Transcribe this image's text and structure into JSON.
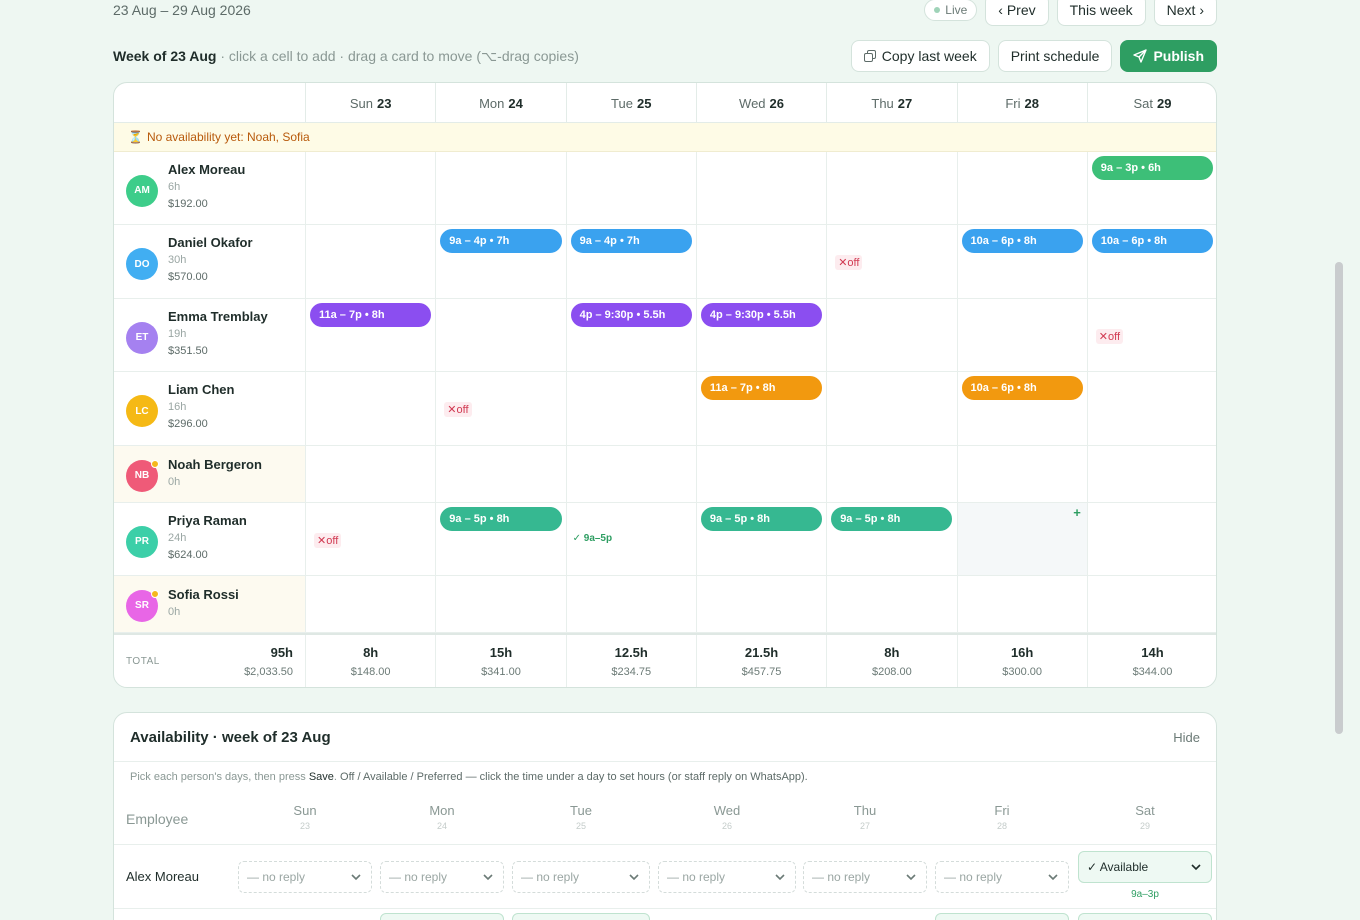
{
  "header": {
    "date_range": "23 Aug – 29 Aug 2026",
    "live_label": "Live",
    "prev_label": "‹ Prev",
    "this_week_label": "This week",
    "next_label": "Next ›"
  },
  "week": {
    "title": "Week of 23 Aug",
    "hint": " · click a cell to add · drag a card to move (⌥-drag copies)",
    "copy_label": "Copy last week",
    "print_label": "Print schedule",
    "publish_label": "Publish"
  },
  "days": [
    {
      "dow": "Sun",
      "num": "23"
    },
    {
      "dow": "Mon",
      "num": "24"
    },
    {
      "dow": "Tue",
      "num": "25"
    },
    {
      "dow": "Wed",
      "num": "26"
    },
    {
      "dow": "Thu",
      "num": "27"
    },
    {
      "dow": "Fri",
      "num": "28"
    },
    {
      "dow": "Sat",
      "num": "29"
    }
  ],
  "notice": {
    "icon": "hourglass-icon",
    "text": "No availability yet: Noah, Sofia"
  },
  "employees": [
    {
      "initials": "AM",
      "name": "Alex Moreau",
      "hours": "6h",
      "cost": "$192.00",
      "color": "#3dcd8a",
      "pending": false,
      "cells": [
        null,
        null,
        null,
        null,
        null,
        null,
        {
          "type": "shift",
          "label": "9a – 3p • 6h"
        }
      ]
    },
    {
      "initials": "DO",
      "name": "Daniel Okafor",
      "hours": "30h",
      "cost": "$570.00",
      "color": "#41aef2",
      "pending": false,
      "cells": [
        null,
        {
          "type": "shift",
          "label": "9a – 4p • 7h"
        },
        {
          "type": "shift",
          "label": "9a – 4p • 7h"
        },
        null,
        {
          "type": "off",
          "label": "✕off"
        },
        {
          "type": "shift",
          "label": "10a – 6p • 8h"
        },
        {
          "type": "shift",
          "label": "10a – 6p • 8h"
        }
      ]
    },
    {
      "initials": "ET",
      "name": "Emma Tremblay",
      "hours": "19h",
      "cost": "$351.50",
      "color": "#a581f0",
      "pending": false,
      "cells": [
        {
          "type": "shift",
          "label": "11a – 7p • 8h"
        },
        null,
        {
          "type": "shift",
          "label": "4p – 9:30p • 5.5h"
        },
        {
          "type": "shift",
          "label": "4p – 9:30p • 5.5h"
        },
        null,
        null,
        {
          "type": "off",
          "label": "✕off"
        }
      ]
    },
    {
      "initials": "LC",
      "name": "Liam Chen",
      "hours": "16h",
      "cost": "$296.00",
      "color": "#f5b915",
      "pending": false,
      "cells": [
        null,
        {
          "type": "off",
          "label": "✕off"
        },
        null,
        {
          "type": "shift",
          "label": "11a – 7p • 8h"
        },
        null,
        {
          "type": "shift",
          "label": "10a – 6p • 8h"
        },
        null
      ]
    },
    {
      "initials": "NB",
      "name": "Noah Bergeron",
      "hours": "0h",
      "cost": "",
      "color": "#ef5a78",
      "pending": true,
      "cells": [
        null,
        null,
        null,
        null,
        null,
        null,
        null
      ]
    },
    {
      "initials": "PR",
      "name": "Priya Raman",
      "hours": "24h",
      "cost": "$624.00",
      "color": "#3ccfa8",
      "pending": false,
      "cells": [
        {
          "type": "off",
          "label": "✕off"
        },
        {
          "type": "shift",
          "label": "9a – 5p • 8h"
        },
        {
          "type": "avail",
          "label": "✓ 9a–5p"
        },
        {
          "type": "shift",
          "label": "9a – 5p • 8h"
        },
        {
          "type": "shift",
          "label": "9a – 5p • 8h"
        },
        {
          "type": "add",
          "label": "+"
        },
        null
      ]
    },
    {
      "initials": "SR",
      "name": "Sofia Rossi",
      "hours": "0h",
      "cost": "",
      "color": "#e866e6",
      "pending": true,
      "cells": [
        null,
        null,
        null,
        null,
        null,
        null,
        null
      ]
    }
  ],
  "shift_colors": {
    "Alex Moreau": "#3dbf78",
    "Daniel Okafor": "#3aa2ef",
    "Emma Tremblay": "#8b4ef0",
    "Liam Chen": "#f2990f",
    "Priya Raman": "#36b891"
  },
  "totals": {
    "label": "TOTAL",
    "overall": {
      "hours": "95h",
      "cost": "$2,033.50"
    },
    "days": [
      {
        "hours": "8h",
        "cost": "$148.00"
      },
      {
        "hours": "15h",
        "cost": "$341.00"
      },
      {
        "hours": "12.5h",
        "cost": "$234.75"
      },
      {
        "hours": "21.5h",
        "cost": "$457.75"
      },
      {
        "hours": "8h",
        "cost": "$208.00"
      },
      {
        "hours": "16h",
        "cost": "$300.00"
      },
      {
        "hours": "14h",
        "cost": "$344.00"
      }
    ]
  },
  "availability": {
    "title": "Availability · week of 23 Aug",
    "hide_label": "Hide",
    "help_pre": "Pick each person's days, then press ",
    "help_save": "Save",
    "help_dot": ". ",
    "help_post": "Off / Available / Preferred — click the time under a day to set hours (or staff reply on WhatsApp).",
    "employee_header": "Employee",
    "rows": [
      {
        "name": "Alex Moreau",
        "cells": [
          {
            "value": "— no reply",
            "time": ""
          },
          {
            "value": "— no reply",
            "time": ""
          },
          {
            "value": "— no reply",
            "time": ""
          },
          {
            "value": "— no reply",
            "time": ""
          },
          {
            "value": "— no reply",
            "time": ""
          },
          {
            "value": "— no reply",
            "time": ""
          },
          {
            "value": "✓ Available",
            "time": "9a–3p"
          }
        ]
      }
    ]
  }
}
